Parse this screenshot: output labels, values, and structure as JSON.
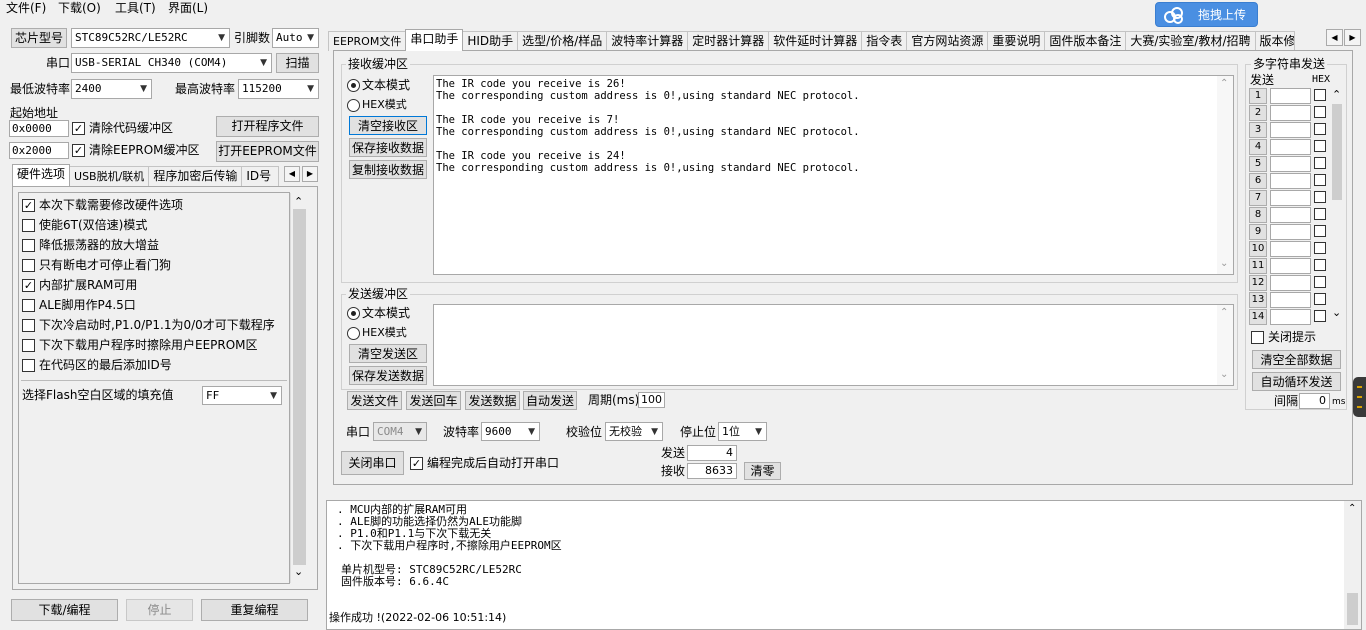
{
  "menu": [
    "文件(F)",
    "下载(O)",
    "工具(T)",
    "界面(L)"
  ],
  "upload_badge": "拖拽上传",
  "left": {
    "chip_button": "芯片型号",
    "chip_value": "STC89C52RC/LE52RC",
    "pins_label": "引脚数",
    "pins_value": "Auto",
    "port_label": "串口",
    "port_value": "USB-SERIAL CH340 (COM4)",
    "scan_button": "扫描",
    "min_baud_label": "最低波特率",
    "min_baud_value": "2400",
    "max_baud_label": "最高波特率",
    "max_baud_value": "115200",
    "start_addr_label": "起始地址",
    "addr1": "0x0000",
    "clear_code_label": "清除代码缓冲区",
    "open_prog_button": "打开程序文件",
    "addr2": "0x2000",
    "clear_eeprom_label": "清除EEPROM缓冲区",
    "open_eeprom_button": "打开EEPROM文件",
    "subtabs": [
      "硬件选项",
      "USB脱机/联机",
      "程序加密后传输",
      "ID号"
    ],
    "options": [
      {
        "label": "本次下载需要修改硬件选项",
        "checked": true
      },
      {
        "label": "使能6T(双倍速)模式",
        "checked": false
      },
      {
        "label": "降低振荡器的放大增益",
        "checked": false
      },
      {
        "label": "只有断电才可停止看门狗",
        "checked": false
      },
      {
        "label": "内部扩展RAM可用",
        "checked": true
      },
      {
        "label": "ALE脚用作P4.5口",
        "checked": false
      },
      {
        "label": "下次冷启动时,P1.0/P1.1为0/0才可下载程序",
        "checked": false
      },
      {
        "label": "下次下载用户程序时擦除用户EEPROM区",
        "checked": false
      },
      {
        "label": "在代码区的最后添加ID号",
        "checked": false
      }
    ],
    "fill_label": "选择Flash空白区域的填充值",
    "fill_value": "FF",
    "download_button": "下载/编程",
    "stop_button": "停止",
    "reprogram_button": "重复编程"
  },
  "main_tabs": [
    "EEPROM文件",
    "串口助手",
    "HID助手",
    "选型/价格/样品",
    "波特率计算器",
    "定时器计算器",
    "软件延时计算器",
    "指令表",
    "官方网站资源",
    "重要说明",
    "固件版本备注",
    "大赛/实验室/教材/招聘",
    "版本修"
  ],
  "active_tab": 1,
  "receive": {
    "title": "接收缓冲区",
    "text_mode": "文本模式",
    "hex_mode": "HEX模式",
    "clear_button": "清空接收区",
    "save_button": "保存接收数据",
    "copy_button": "复制接收数据",
    "lines": [
      "The IR code you receive is 26!",
      "The corresponding custom address is 0!,using standard NEC protocol.",
      "",
      "The IR code you receive is 7!",
      "The corresponding custom address is 0!,using standard NEC protocol.",
      "",
      "The IR code you receive is 24!",
      "The corresponding custom address is 0!,using standard NEC protocol."
    ]
  },
  "send": {
    "title": "发送缓冲区",
    "text_mode": "文本模式",
    "hex_mode": "HEX模式",
    "clear_button": "清空发送区",
    "save_button": "保存发送数据",
    "send_file": "发送文件",
    "send_enter": "发送回车",
    "send_data": "发送数据",
    "auto_send": "自动发送",
    "period_label": "周期(ms)",
    "period_value": "100"
  },
  "serial": {
    "port_label": "串口",
    "port_value": "COM4",
    "baud_label": "波特率",
    "baud_value": "9600",
    "parity_label": "校验位",
    "parity_value": "无校验",
    "stop_label": "停止位",
    "stop_value": "1位",
    "close_button": "关闭串口",
    "auto_open_label": "编程完成后自动打开串口",
    "sent_label": "发送",
    "sent_value": "4",
    "recv_label": "接收",
    "recv_value": "8633",
    "clear_button": "清零"
  },
  "multi": {
    "title": "多字符串发送",
    "send_header": "发送",
    "hex_header": "HEX",
    "rows": [
      "1",
      "2",
      "3",
      "4",
      "5",
      "6",
      "7",
      "8",
      "9",
      "10",
      "11",
      "12",
      "13",
      "14"
    ],
    "close_tip": "关闭提示",
    "clear_all": "清空全部数据",
    "auto_loop": "自动循环发送",
    "interval_label": "间隔",
    "interval_value": "0",
    "interval_unit": "ms"
  },
  "log": {
    "lines": [
      ". MCU内部的扩展RAM可用",
      ". ALE脚的功能选择仍然为ALE功能脚",
      ". P1.0和P1.1与下次下载无关",
      ". 下次下载用户程序时,不擦除用户EEPROM区",
      "",
      "单片机型号: STC89C52RC/LE52RC",
      "固件版本号: 6.6.4C",
      "",
      "",
      "操作成功 !(2022-02-06 10:51:14)"
    ]
  }
}
